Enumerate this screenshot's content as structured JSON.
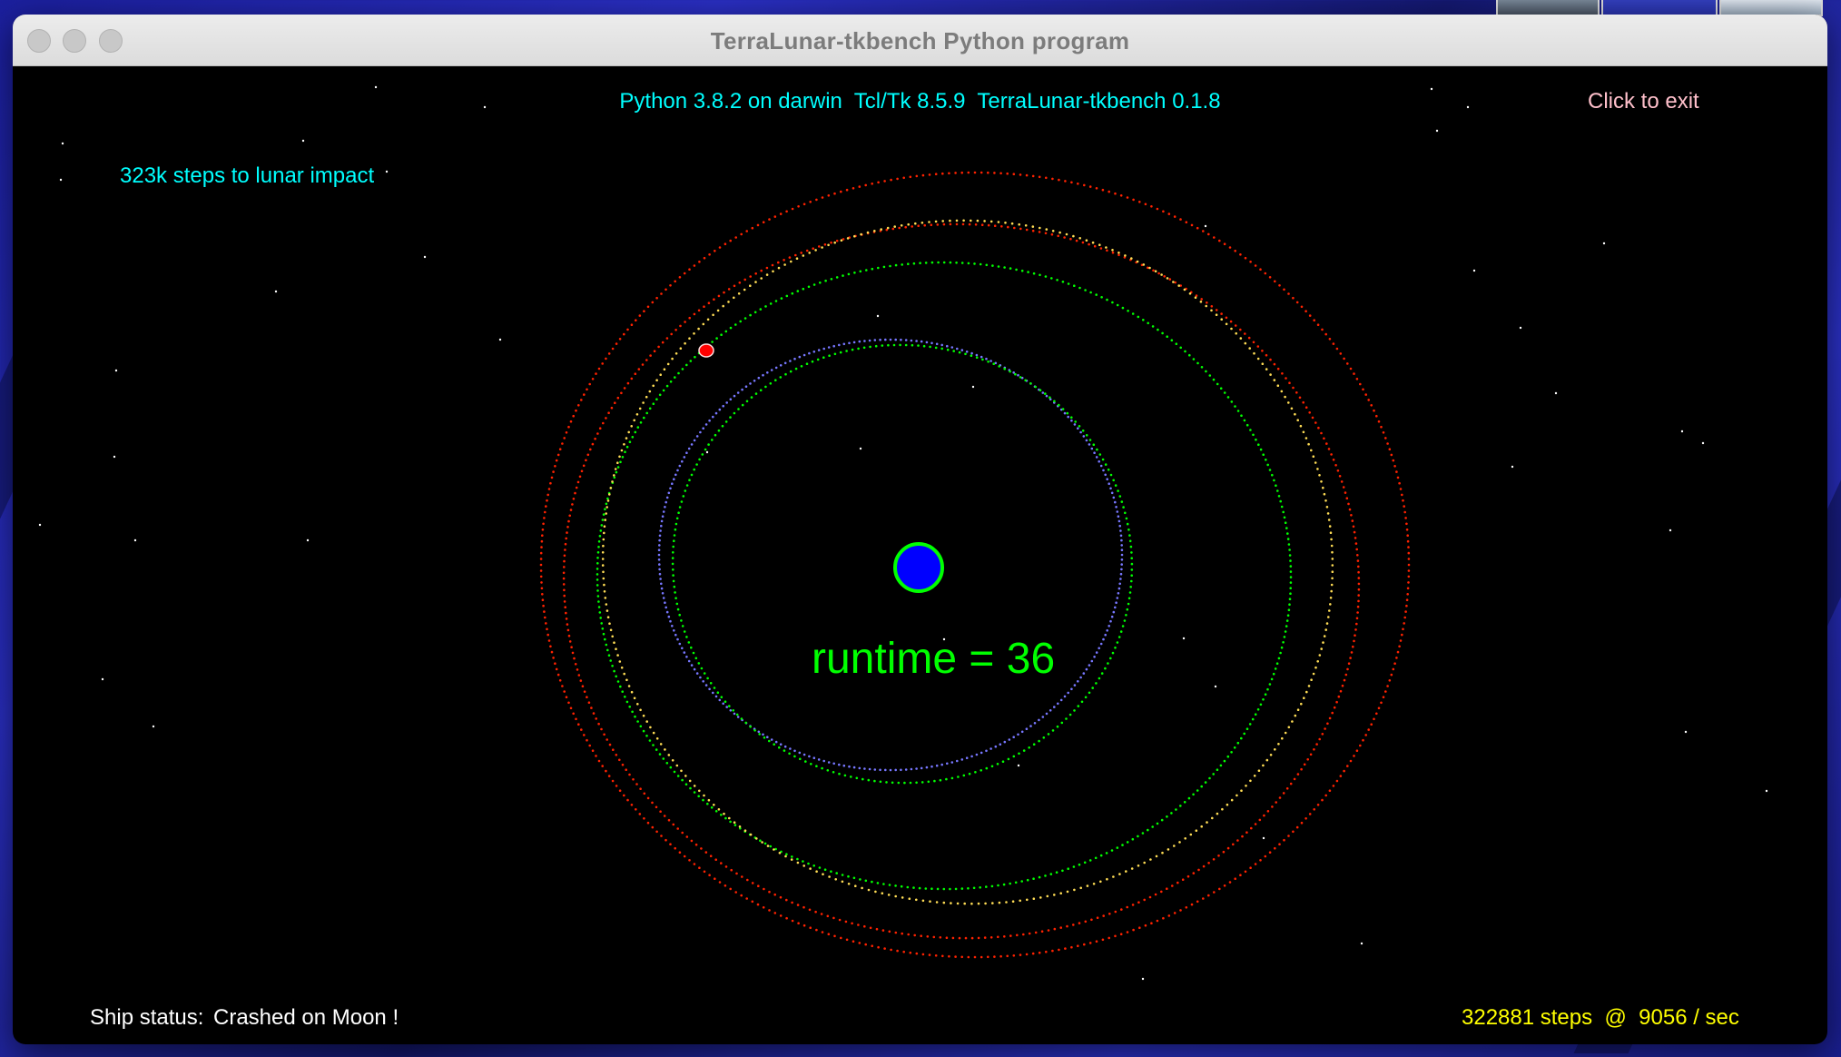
{
  "window": {
    "title": "TerraLunar-tkbench Python program"
  },
  "header": {
    "version_info": "Python 3.8.2 on darwin  Tcl/Tk 8.5.9  TerraLunar-tkbench 0.1.8",
    "exit_label": "Click to exit"
  },
  "info": {
    "impact_steps": "323k steps to lunar impact"
  },
  "center": {
    "runtime_label": "runtime = 36"
  },
  "footer": {
    "ship_status_label": "Ship status:",
    "ship_status_value": "Crashed on Moon !",
    "steps_rate": "322881 steps  @  9056 / sec"
  },
  "colors": {
    "background": "#000000",
    "earth_fill": "#0000ff",
    "earth_outline": "#00ff00",
    "moon": "#ff0000",
    "text_cyan": "#00ffff",
    "text_pink": "#ffc0cb",
    "text_yellow": "#ffff00",
    "runtime_green": "#00ff00",
    "orbit_red": "#ff2200",
    "orbit_green": "#00ff00",
    "orbit_blue": "#7777ff",
    "star": "#ffffff"
  },
  "icons": {
    "earth": "earth-icon",
    "moon": "moon-icon",
    "close": "close-icon",
    "minimize": "minimize-icon",
    "zoom": "zoom-icon"
  }
}
